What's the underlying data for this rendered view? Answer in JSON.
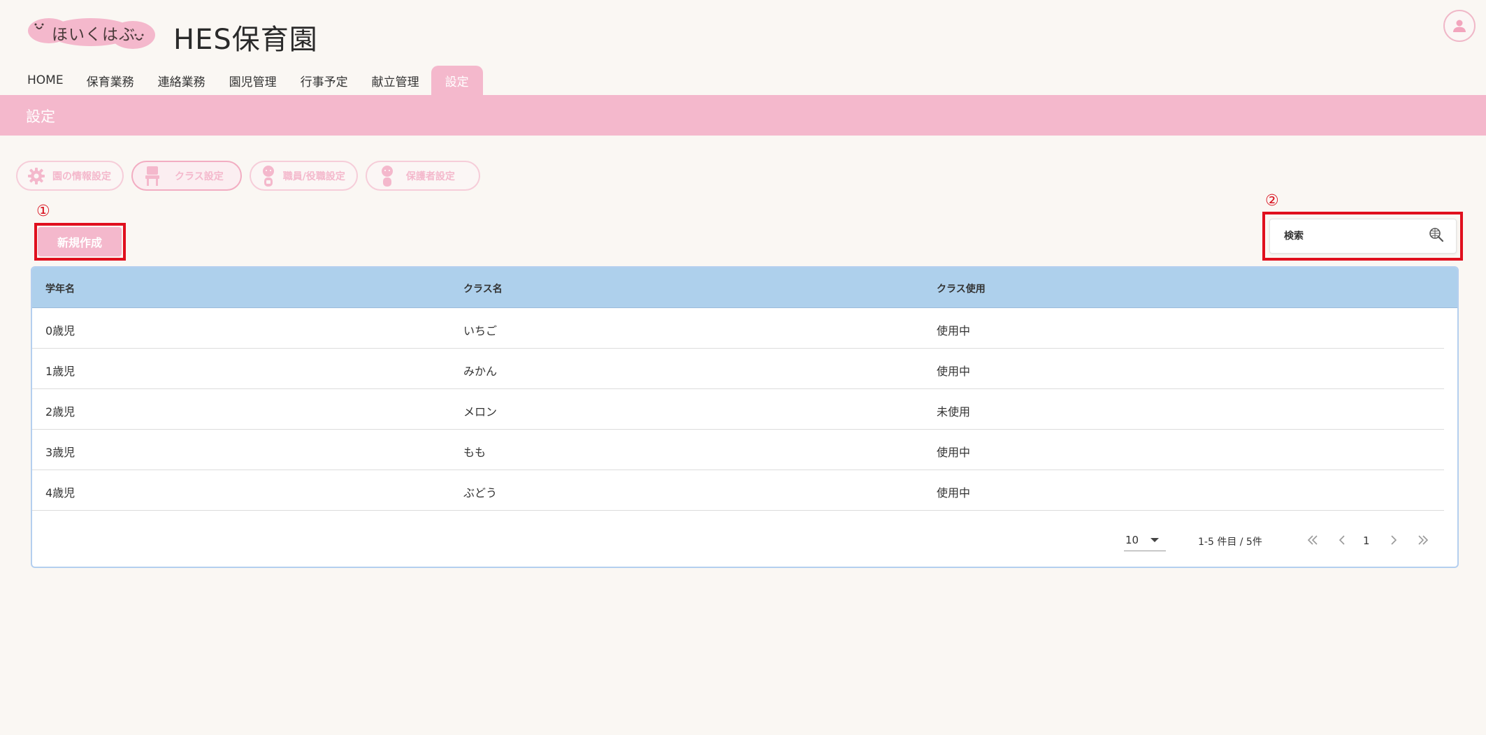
{
  "header": {
    "logo_text": "ほいくはぶ",
    "app_title": "HES保育園"
  },
  "nav": {
    "items": [
      {
        "label": "HOME"
      },
      {
        "label": "保育業務"
      },
      {
        "label": "連絡業務"
      },
      {
        "label": "園児管理"
      },
      {
        "label": "行事予定"
      },
      {
        "label": "献立管理"
      },
      {
        "label": "設定"
      }
    ],
    "active_index": 6
  },
  "section": {
    "title": "設定"
  },
  "subtabs": [
    {
      "label": "園の情報設定",
      "icon": "gear-icon"
    },
    {
      "label": "クラス設定",
      "icon": "chair-icon"
    },
    {
      "label": "職員/役職設定",
      "icon": "staff-icon"
    },
    {
      "label": "保護者設定",
      "icon": "guardian-icon"
    }
  ],
  "annotations": {
    "one": "①",
    "two": "②"
  },
  "toolbar": {
    "new_label": "新規作成",
    "search_placeholder": "検索"
  },
  "table": {
    "columns": [
      "学年名",
      "クラス名",
      "クラス使用"
    ],
    "rows": [
      [
        "0歳児",
        "いちご",
        "使用中"
      ],
      [
        "1歳児",
        "みかん",
        "使用中"
      ],
      [
        "2歳児",
        "メロン",
        "未使用"
      ],
      [
        "3歳児",
        "もも",
        "使用中"
      ],
      [
        "4歳児",
        "ぶどう",
        "使用中"
      ]
    ]
  },
  "pagination": {
    "rows_per_page": "10",
    "range": "1-5 件目 / 5件",
    "current_page": "1"
  },
  "colors": {
    "accent_pink": "#f4b8cc",
    "header_blue": "#aed0ec",
    "annotation_red": "#e0101e"
  }
}
